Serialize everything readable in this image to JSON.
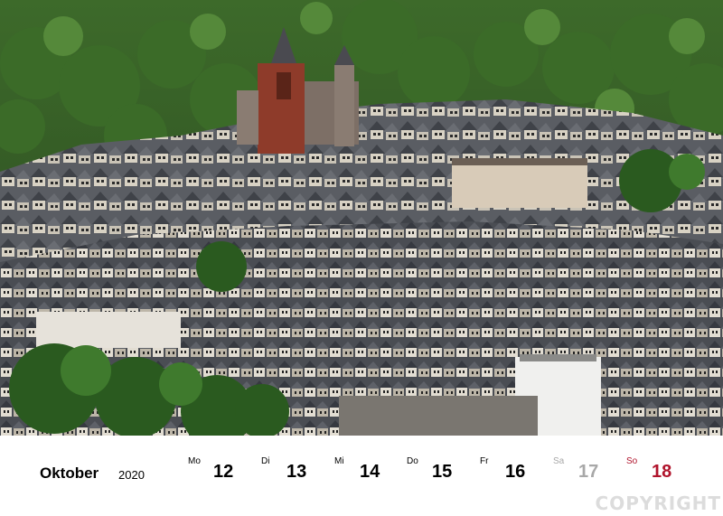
{
  "photo": {
    "subject": "town panorama",
    "colors": {
      "forest": "#2f5a23",
      "roof": "#4b4e55",
      "wall": "#d9d4c8",
      "tower": "#8e3b2a"
    }
  },
  "calendar": {
    "month": "Oktober",
    "year": "2020",
    "days": [
      {
        "dow": "Mo",
        "num": "12"
      },
      {
        "dow": "Di",
        "num": "13"
      },
      {
        "dow": "Mi",
        "num": "14"
      },
      {
        "dow": "Do",
        "num": "15"
      },
      {
        "dow": "Fr",
        "num": "16"
      },
      {
        "dow": "Sa",
        "num": "17"
      },
      {
        "dow": "So",
        "num": "18"
      }
    ],
    "colors": {
      "weekday": "#000000",
      "saturday": "#a8a8a8",
      "sunday": "#b0142c"
    }
  },
  "watermark": "COPYRIGHT"
}
